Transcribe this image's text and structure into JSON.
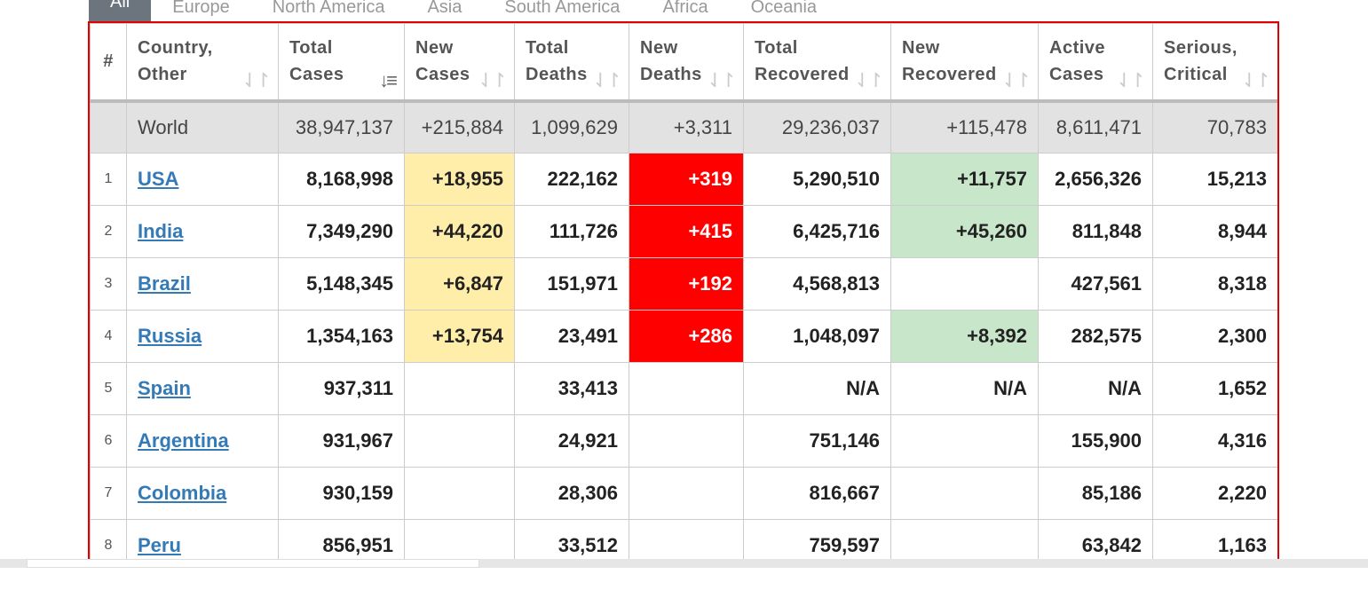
{
  "tabs": [
    "All",
    "Europe",
    "North America",
    "Asia",
    "South America",
    "Africa",
    "Oceania"
  ],
  "headers": [
    {
      "l1": "#",
      "l2": ""
    },
    {
      "l1": "Country,",
      "l2": "Other"
    },
    {
      "l1": "Total",
      "l2": "Cases"
    },
    {
      "l1": "New",
      "l2": "Cases"
    },
    {
      "l1": "Total",
      "l2": "Deaths"
    },
    {
      "l1": "New",
      "l2": "Deaths"
    },
    {
      "l1": "Total",
      "l2": "Recovered"
    },
    {
      "l1": "New",
      "l2": "Recovered"
    },
    {
      "l1": "Active",
      "l2": "Cases"
    },
    {
      "l1": "Serious,",
      "l2": "Critical"
    }
  ],
  "sort_icon": "⇃↾",
  "world": {
    "name": "World",
    "total_cases": "38,947,137",
    "new_cases": "+215,884",
    "total_deaths": "1,099,629",
    "new_deaths": "+3,311",
    "total_recovered": "29,236,037",
    "new_recovered": "+115,478",
    "active": "8,611,471",
    "critical": "70,783"
  },
  "rows": [
    {
      "rank": "1",
      "name": "USA",
      "total_cases": "8,168,998",
      "new_cases": "+18,955",
      "total_deaths": "222,162",
      "new_deaths": "+319",
      "total_recovered": "5,290,510",
      "new_recovered": "+11,757",
      "active": "2,656,326",
      "critical": "15,213"
    },
    {
      "rank": "2",
      "name": "India",
      "total_cases": "7,349,290",
      "new_cases": "+44,220",
      "total_deaths": "111,726",
      "new_deaths": "+415",
      "total_recovered": "6,425,716",
      "new_recovered": "+45,260",
      "active": "811,848",
      "critical": "8,944"
    },
    {
      "rank": "3",
      "name": "Brazil",
      "total_cases": "5,148,345",
      "new_cases": "+6,847",
      "total_deaths": "151,971",
      "new_deaths": "+192",
      "total_recovered": "4,568,813",
      "new_recovered": "",
      "active": "427,561",
      "critical": "8,318"
    },
    {
      "rank": "4",
      "name": "Russia",
      "total_cases": "1,354,163",
      "new_cases": "+13,754",
      "total_deaths": "23,491",
      "new_deaths": "+286",
      "total_recovered": "1,048,097",
      "new_recovered": "+8,392",
      "active": "282,575",
      "critical": "2,300"
    },
    {
      "rank": "5",
      "name": "Spain",
      "total_cases": "937,311",
      "new_cases": "",
      "total_deaths": "33,413",
      "new_deaths": "",
      "total_recovered": "N/A",
      "new_recovered": "N/A",
      "active": "N/A",
      "critical": "1,652"
    },
    {
      "rank": "6",
      "name": "Argentina",
      "total_cases": "931,967",
      "new_cases": "",
      "total_deaths": "24,921",
      "new_deaths": "",
      "total_recovered": "751,146",
      "new_recovered": "",
      "active": "155,900",
      "critical": "4,316"
    },
    {
      "rank": "7",
      "name": "Colombia",
      "total_cases": "930,159",
      "new_cases": "",
      "total_deaths": "28,306",
      "new_deaths": "",
      "total_recovered": "816,667",
      "new_recovered": "",
      "active": "85,186",
      "critical": "2,220"
    },
    {
      "rank": "8",
      "name": "Peru",
      "total_cases": "856,951",
      "new_cases": "",
      "total_deaths": "33,512",
      "new_deaths": "",
      "total_recovered": "759,597",
      "new_recovered": "",
      "active": "63,842",
      "critical": "1,163"
    }
  ],
  "colors": {
    "new_cases_bg": "#ffeeaa",
    "new_deaths_bg": "#ff0000",
    "new_recovered_bg": "#c8e6c9",
    "highlight_border": "#e00000",
    "link": "#337ab7"
  }
}
